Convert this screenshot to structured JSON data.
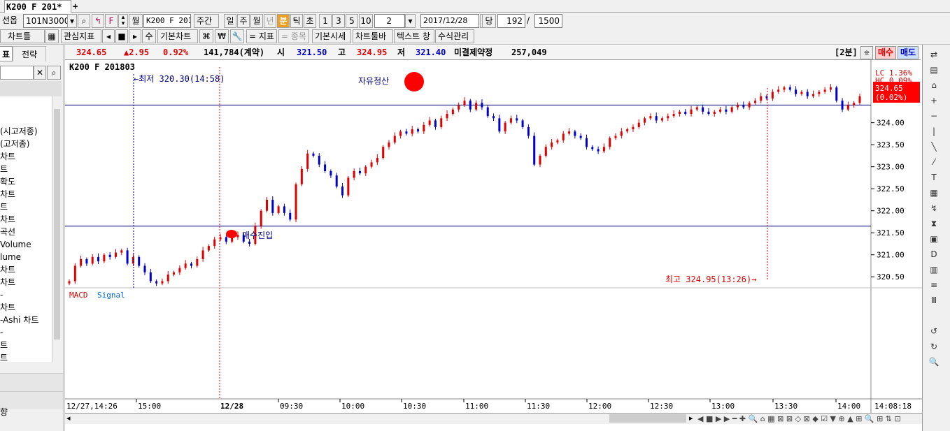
{
  "tabbar": {
    "tab_title": "K200 F 201*",
    "add_label": "+"
  },
  "toolbar1": {
    "market_label": "선옵",
    "code_value": "101N3000",
    "search_glyph": "🔍",
    "wol_label": "월",
    "name_value": "K200 F 2018",
    "period_label": "주간",
    "day_label": "일",
    "week_label": "주",
    "month_label": "월",
    "year_label": "년",
    "minute_label": "분",
    "tick_label": "틱",
    "sec_label": "초",
    "n1": "1",
    "n3": "3",
    "n5": "5",
    "n10": "10",
    "interval_value": "2",
    "date_value": "2017/12/28",
    "dang_label": "당",
    "count_value": "192",
    "slash": "/",
    "total_value": "1500"
  },
  "toolbar2": {
    "chart_tool_label": "차트틀",
    "indicator_label": "관심지표",
    "su_label": "수",
    "basic_chart_label": "기본차트",
    "won_label": "₩",
    "indicator_eq_label": "= 지표",
    "item_eq_label": "= 종목",
    "basic_quote_label": "기본시세",
    "chart_toolbar_label": "차트툴바",
    "text_window_label": "텍스트 창",
    "formula_label": "수식관리"
  },
  "leftpanel": {
    "tab1": "표",
    "tab2": "전략",
    "items": [
      "(시고저종)",
      "(고저종)",
      "차트",
      "트",
      "확도",
      "차트",
      "트",
      "차트",
      "곡선",
      "Volume",
      "lume",
      "차트",
      "차트",
      "-",
      "차트",
      "-Ashi 차트",
      "-",
      "트",
      "트"
    ],
    "bottom_label": "향"
  },
  "quote": {
    "price": "324.65",
    "change": "▲2.95",
    "pct": "0.92%",
    "volume": "141,784(계약)",
    "open_label": "시",
    "open": "321.50",
    "high_label": "고",
    "high": "324.95",
    "low_label": "저",
    "low": "321.40",
    "oi_label": "미결제약정",
    "oi": "257,049",
    "interval": "[2분]",
    "buy": "매수",
    "sell": "매도"
  },
  "chart": {
    "symbol": "K200 F 201803",
    "lc_label": "LC 1.36%",
    "hc_label": "HC 0.09%",
    "cur_price": "324.65",
    "cur_pct": "(0.02%)",
    "low_annot": "←최저 320.30(14:58)",
    "high_annot": "최고 324.95(13:26)→",
    "exit_label": "자유청산",
    "entry_label": "매수진입",
    "macd_label": "MACD",
    "signal_label": "Signal",
    "date_start": "12/27,14:26",
    "date_mark": "12/28",
    "time_now": "14:08:18",
    "colors": {
      "up": "#e00000",
      "down": "#0000cc",
      "line": "#000080"
    }
  },
  "chart_data": {
    "type": "candlestick",
    "y_ticks": [
      "324.00",
      "323.50",
      "323.00",
      "322.50",
      "322.00",
      "321.50",
      "321.00",
      "320.50"
    ],
    "x_ticks": [
      "15:00",
      "09:30",
      "10:00",
      "10:30",
      "11:00",
      "11:30",
      "12:00",
      "12:30",
      "13:00",
      "13:30",
      "14:00"
    ],
    "ylim": [
      320.25,
      325.2
    ],
    "hlines": [
      324.4,
      321.65
    ],
    "closes": [
      320.4,
      320.75,
      320.9,
      320.8,
      320.95,
      320.85,
      321.0,
      320.95,
      321.05,
      321.1,
      320.8,
      320.95,
      320.75,
      320.6,
      320.4,
      320.35,
      320.4,
      320.55,
      320.6,
      320.7,
      320.8,
      320.75,
      320.9,
      321.1,
      321.2,
      321.35,
      321.4,
      321.3,
      321.4,
      321.45,
      321.3,
      321.25,
      321.65,
      322.0,
      322.25,
      321.95,
      322.1,
      321.95,
      321.8,
      322.6,
      322.95,
      323.3,
      323.25,
      323.05,
      322.9,
      322.8,
      322.55,
      322.35,
      322.75,
      322.9,
      322.85,
      323.0,
      323.1,
      323.2,
      323.45,
      323.55,
      323.7,
      323.8,
      323.75,
      323.85,
      323.8,
      323.95,
      324.05,
      323.9,
      324.1,
      324.2,
      324.3,
      324.4,
      324.5,
      324.3,
      324.45,
      324.35,
      324.15,
      324.1,
      323.8,
      324.0,
      324.1,
      324.05,
      323.9,
      323.7,
      323.05,
      323.25,
      323.45,
      323.55,
      323.6,
      323.75,
      323.8,
      323.7,
      323.65,
      323.45,
      323.4,
      323.35,
      323.45,
      323.65,
      323.7,
      323.8,
      323.85,
      323.9,
      324.0,
      324.1,
      324.15,
      324.05,
      324.1,
      324.15,
      324.2,
      324.25,
      324.2,
      324.3,
      324.35,
      324.25,
      324.2,
      324.25,
      324.3,
      324.25,
      324.35,
      324.4,
      324.35,
      324.45,
      324.5,
      324.6,
      324.55,
      324.7,
      324.75,
      324.8,
      324.75,
      324.65,
      324.7,
      324.6,
      324.65,
      324.7,
      324.75,
      324.8,
      324.5,
      324.3,
      324.4,
      324.45,
      324.6
    ],
    "macd_series": [
      "MACD",
      "Signal"
    ]
  },
  "rtools": {
    "icons": [
      "⇄",
      "▤",
      "⌂",
      "+",
      "−",
      "|",
      "╲",
      "⁄",
      "T",
      "▦",
      "↯",
      "⧗",
      "▣",
      "D",
      "▥",
      "≡",
      "Ⅲ",
      "↺",
      "↻",
      "🔍"
    ]
  },
  "hscroll": {
    "left_arrow": "◂",
    "right_arrow": "▸"
  }
}
